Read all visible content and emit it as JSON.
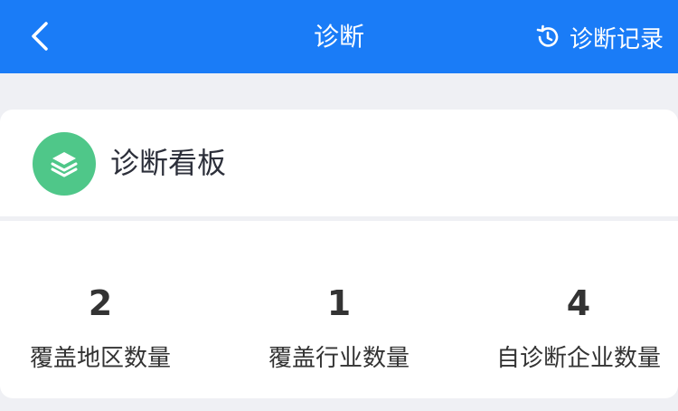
{
  "header": {
    "title": "诊断",
    "back_icon": "chevron-left-icon",
    "history_icon": "history-icon",
    "history_label": "诊断记录",
    "background_color": "#1a7cf7"
  },
  "board": {
    "icon": "layers-icon",
    "icon_color": "#4fc789",
    "title": "诊断看板"
  },
  "stats": [
    {
      "value": "2",
      "label": "覆盖地区数量"
    },
    {
      "value": "1",
      "label": "覆盖行业数量"
    },
    {
      "value": "4",
      "label": "自诊断企业数量"
    }
  ]
}
